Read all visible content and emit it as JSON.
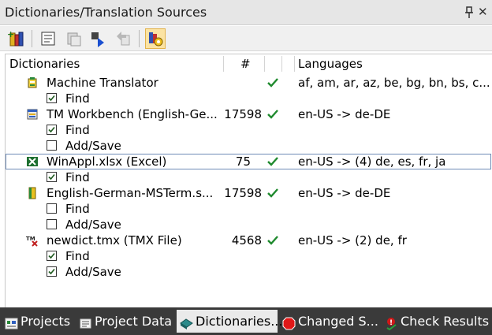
{
  "window": {
    "title": "Dictionaries/Translation Sources"
  },
  "columns": {
    "name": "Dictionaries",
    "count": "#",
    "languages": "Languages"
  },
  "dictionaries": [
    {
      "name": "Machine Translator",
      "count": "",
      "enabled": true,
      "languages": "af, am, ar, az, be, bg, bn, bs, c...",
      "icon": "machine-translator-icon",
      "options": [
        {
          "label": "Find",
          "checked": true
        }
      ]
    },
    {
      "name": "TM Workbench (English-Ge...",
      "count": "17598",
      "enabled": true,
      "languages": "en-US -> de-DE",
      "icon": "tm-workbench-icon",
      "options": [
        {
          "label": "Find",
          "checked": true
        },
        {
          "label": "Add/Save",
          "checked": false
        }
      ]
    },
    {
      "name": "WinAppl.xlsx (Excel)",
      "count": "75",
      "enabled": true,
      "languages": "en-US -> (4) de, es, fr, ja",
      "icon": "excel-icon",
      "selected": true,
      "options": [
        {
          "label": "Find",
          "checked": true
        }
      ]
    },
    {
      "name": "English-German-MSTerm.s...",
      "count": "17598",
      "enabled": true,
      "languages": "en-US -> de-DE",
      "icon": "term-database-icon",
      "options": [
        {
          "label": "Find",
          "checked": false
        },
        {
          "label": "Add/Save",
          "checked": false
        }
      ]
    },
    {
      "name": "newdict.tmx (TMX File)",
      "count": "4568",
      "enabled": true,
      "languages": "en-US -> (2) de, fr",
      "icon": "tmx-file-icon",
      "options": [
        {
          "label": "Find",
          "checked": true
        },
        {
          "label": "Add/Save",
          "checked": true
        }
      ]
    }
  ],
  "bottom_tabs": [
    {
      "label": "Projects",
      "icon": "projects-icon",
      "active": false
    },
    {
      "label": "Project Data",
      "icon": "project-data-icon",
      "active": false
    },
    {
      "label": "Dictionaries...",
      "icon": "dictionaries-icon",
      "active": true
    },
    {
      "label": "Changed S...",
      "icon": "stop-icon",
      "active": false
    },
    {
      "label": "Check Results",
      "icon": "check-results-icon",
      "active": false
    }
  ],
  "colors": {
    "checkmark": "#1f8a2e",
    "selection_border": "#6e8bb6",
    "bottom_bar": "#3a3a3a"
  }
}
